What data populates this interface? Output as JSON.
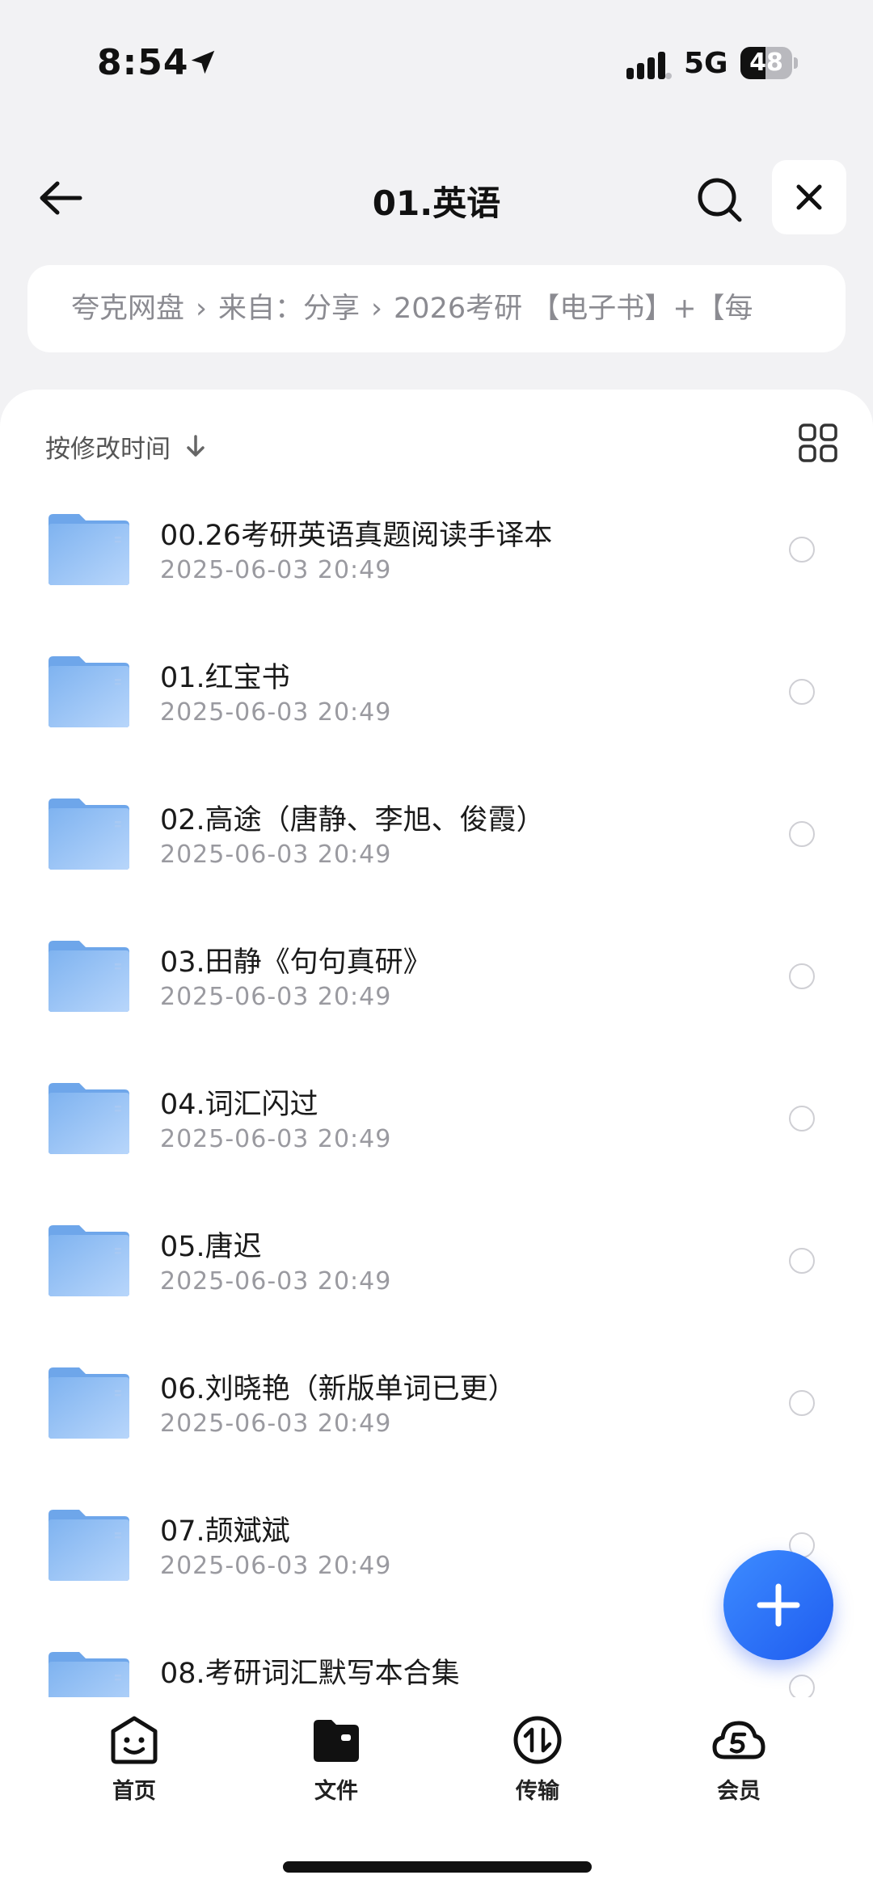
{
  "status_bar": {
    "time": "8:54",
    "network": "5G",
    "battery": "48",
    "battery_level": 0.48
  },
  "header": {
    "title": "01.英语"
  },
  "breadcrumb": {
    "items": [
      "夸克网盘",
      "来自：分享",
      "2026考研 【电子书】+【每"
    ]
  },
  "sort": {
    "label": "按修改时间"
  },
  "files": [
    {
      "name": "00.26考研英语真题阅读手译本",
      "date": "2025-06-03 20:49"
    },
    {
      "name": "01.红宝书",
      "date": "2025-06-03 20:49"
    },
    {
      "name": "02.高途（唐静、李旭、俊霞）",
      "date": "2025-06-03 20:49"
    },
    {
      "name": "03.田静《句句真研》",
      "date": "2025-06-03 20:49"
    },
    {
      "name": "04.词汇闪过",
      "date": "2025-06-03 20:49"
    },
    {
      "name": "05.唐迟",
      "date": "2025-06-03 20:49"
    },
    {
      "name": "06.刘晓艳（新版单词已更）",
      "date": "2025-06-03 20:49"
    },
    {
      "name": "07.颉斌斌",
      "date": "2025-06-03 20:49"
    },
    {
      "name": "08.考研词汇默写本合集",
      "date": ""
    }
  ],
  "tabs": [
    {
      "label": "首页",
      "icon": "smiley-home-icon"
    },
    {
      "label": "文件",
      "icon": "folder-icon"
    },
    {
      "label": "传输",
      "icon": "transfer-icon"
    },
    {
      "label": "会员",
      "icon": "cloud-member-icon"
    }
  ],
  "colors": {
    "accent": "#2f74ff",
    "folder": "#8cbcf5"
  }
}
